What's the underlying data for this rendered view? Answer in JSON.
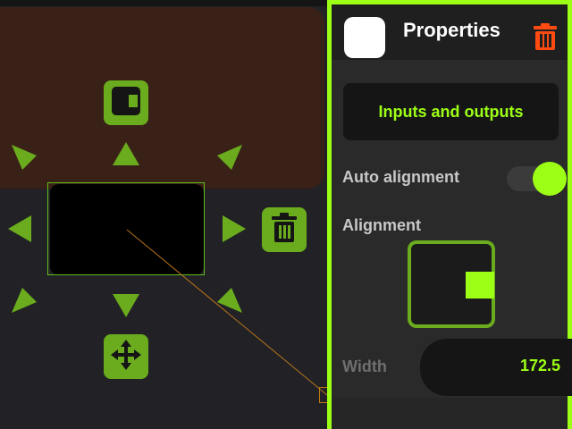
{
  "properties": {
    "title": "Properties",
    "inputs_outputs_label": "Inputs and outputs",
    "auto_alignment": {
      "label": "Auto alignment",
      "enabled": true
    },
    "alignment": {
      "label": "Alignment",
      "value": "right-center"
    },
    "width": {
      "label": "Width",
      "value": "172.5"
    }
  },
  "icons": {
    "widget_alignment": "alignment-icon",
    "delete_widget": "trash-icon",
    "move_widget": "move-arrows-icon",
    "properties_delete": "trash-icon"
  },
  "colors": {
    "accent": "#9dff15",
    "handle_green": "#6aac1d",
    "delete_red": "#ff4b12",
    "container_brown": "#3a2118",
    "background": "#222226"
  }
}
